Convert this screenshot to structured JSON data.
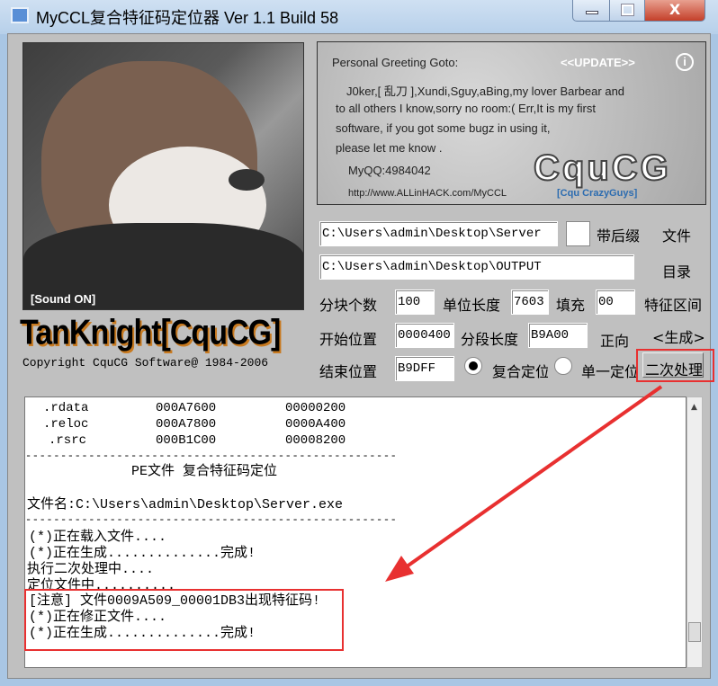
{
  "window": {
    "title": "MyCCL复合特征码定位器  Ver 1.1  Build 58",
    "close_label": "X"
  },
  "left": {
    "sound_label": "[Sound ON]",
    "logo_text": "TanKnight[CquCG]",
    "copyright": "Copyright CquCG Software@ 1984-2006"
  },
  "banner": {
    "greeting_title": "Personal Greeting Goto:",
    "update_link": "<<UPDATE>>",
    "info_icon": "i",
    "lines": [
      "J0ker,[ 乱刀 ],Xundi,Sguy,aBing,my lover Barbear and",
      "to all others I know,sorry no room:(  Err,It is my first",
      "software, if you got some bugz in using it,",
      "please let me know ."
    ],
    "qq": "MyQQ:4984042",
    "url": "http://www.ALLinHACK.com/MyCCL",
    "logo": "CquCG",
    "logo_sub": "[Cqu CrazyGuys]"
  },
  "form": {
    "file_path": "C:\\Users\\admin\\Desktop\\Server",
    "suffix_label": "带后缀",
    "file_button": "文件",
    "output_path": "C:\\Users\\admin\\Desktop\\OUTPUT",
    "dir_button": "目录",
    "blocks_label": "分块个数",
    "blocks": "100",
    "unit_label": "单位长度",
    "unit": "7603",
    "fill_label": "填充",
    "fill": "00",
    "range_button": "特征区间",
    "start_label": "开始位置",
    "start": "0000400",
    "segment_label": "分段长度",
    "segment": "B9A00",
    "direction_button": "正向",
    "generate_button": "<生成>",
    "end_label": "结束位置",
    "end": "B9DFF",
    "radio_composite": "复合定位",
    "radio_single": "单一定位",
    "selected_mode": "复合定位",
    "second_pass_button": "二次处理"
  },
  "log": {
    "sections": [
      [
        ".rdata",
        "000A7600",
        "00000200"
      ],
      [
        ".reloc",
        "000A7800",
        "0000A400"
      ],
      [
        ".rsrc",
        "000B1C00",
        "00008200"
      ]
    ],
    "divider": "-----------------------------------------------------",
    "heading": "PE文件 复合特征码定位",
    "filename": "文件名:C:\\Users\\admin\\Desktop\\Server.exe",
    "lines": [
      "(*)正在载入文件....",
      "(*)正在生成..............完成!",
      "执行二次处理中....",
      "定位文件中..........",
      "[注意] 文件0009A509_00001DB3出现特征码!",
      "(*)正在修正文件....",
      "(*)正在生成..............完成!"
    ]
  },
  "annotation_color": "#e83030"
}
